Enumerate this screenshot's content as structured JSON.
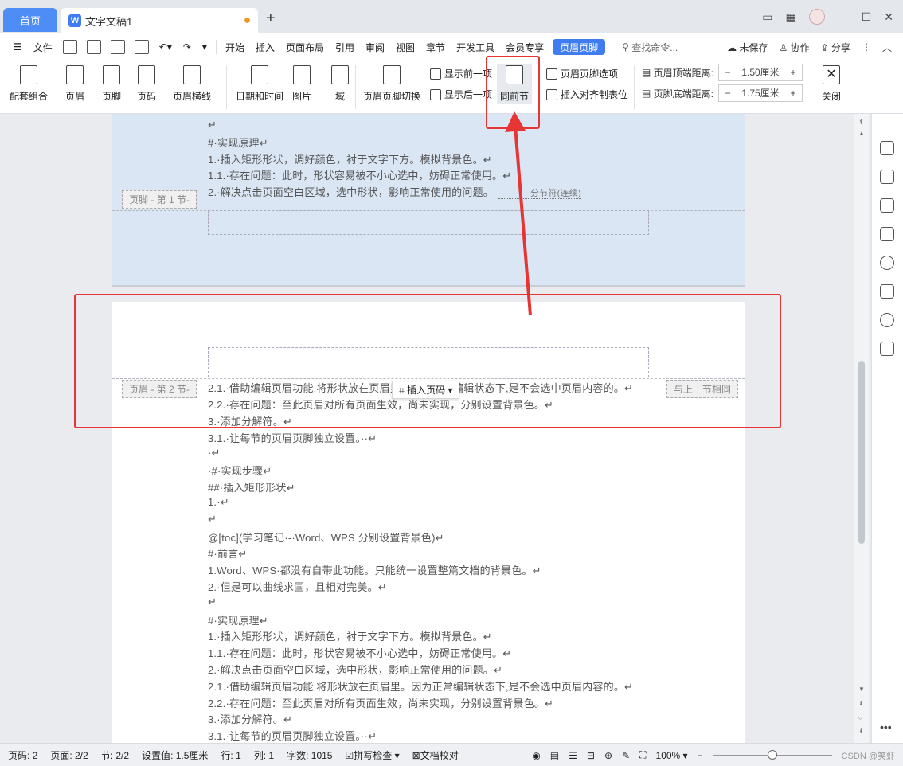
{
  "tabs": {
    "home": "首页",
    "doc": "文字文稿1",
    "new": "+"
  },
  "menubar": {
    "file": "文件",
    "items": [
      "开始",
      "插入",
      "页面布局",
      "引用",
      "审阅",
      "视图",
      "章节",
      "开发工具",
      "会员专享"
    ],
    "active": "页眉页脚",
    "search": "查找命令...",
    "unsaved": "未保存",
    "collab": "协作",
    "share": "分享"
  },
  "ribbon": {
    "combo": "配套组合",
    "header": "页眉",
    "footer": "页脚",
    "page_number": "页码",
    "header_line": "页眉横线",
    "datetime": "日期和时间",
    "picture": "图片",
    "field": "域",
    "switch": "页眉页脚切换",
    "show_prev": "显示前一项",
    "show_next": "显示后一项",
    "same_as_prev": "同前节",
    "hf_options": "页眉页脚选项",
    "insert_align_tab": "插入对齐制表位",
    "top_dist_label": "页眉顶端距离:",
    "top_dist_value": "1.50厘米",
    "bottom_dist_label": "页脚底端距离:",
    "bottom_dist_value": "1.75厘米",
    "close": "关闭"
  },
  "page1": {
    "lines": [
      "↵",
      "#·实现原理↵",
      "1.·插入矩形形状，调好颜色，衬于文字下方。模拟背景色。↵",
      "1.1.·存在问题：此时，形状容易被不小心选中，妨碍正常使用。↵",
      "2.·解决点击页面空白区域，选中形状，影响正常使用的问题。"
    ],
    "section_break": "分节符(连续)",
    "footer_label": "页脚 - 第 1 节-"
  },
  "page2": {
    "header_label": "页眉 - 第 2 节-",
    "same_as_prev": "与上一节相同",
    "insert_page_number": "插入页码",
    "lines": [
      "2.1.·借助编辑页眉功能,将形状放在页眉里。因为正常编辑状态下,是不会选中页眉内容的。↵",
      "2.2.·存在问题：至此页眉对所有页面生效，尚未实现，分别设置背景色。↵",
      "3.·添加分解符。↵",
      "3.1.·让每节的页眉页脚独立设置。··↵",
      "·↵",
      "·#·实现步骤↵",
      "##·插入矩形形状↵",
      "1.·↵",
      "↵",
      "@[toc](学习笔记·-·Word、WPS 分别设置背景色)↵",
      "#·前言↵",
      "1.Word、WPS·都没有自带此功能。只能统一设置整篇文档的背景色。↵",
      "2.·但是可以曲线求国，且相对完美。↵",
      "↵",
      "#·实现原理↵",
      "1.·插入矩形形状，调好颜色，衬于文字下方。模拟背景色。↵",
      "1.1.·存在问题：此时，形状容易被不小心选中，妨碍正常使用。↵",
      "2.·解决点击页面空白区域，选中形状，影响正常使用的问题。↵",
      "2.1.·借助编辑页眉功能,将形状放在页眉里。因为正常编辑状态下,是不会选中页眉内容的。↵",
      "2.2.·存在问题：至此页眉对所有页面生效，尚未实现，分别设置背景色。↵",
      "3.·添加分解符。↵",
      "3.1.·让每节的页眉页脚独立设置。··↵"
    ]
  },
  "status": {
    "page": "页码: 2",
    "pages": "页面: 2/2",
    "section": "节: 2/2",
    "setting": "设置值: 1.5厘米",
    "row": "行: 1",
    "col": "列: 1",
    "words": "字数: 1015",
    "spell": "拼写检查",
    "proof": "文档校对",
    "zoom": "100%",
    "zoom_level": 0.5,
    "watermark": "CSDN @笑虾"
  }
}
